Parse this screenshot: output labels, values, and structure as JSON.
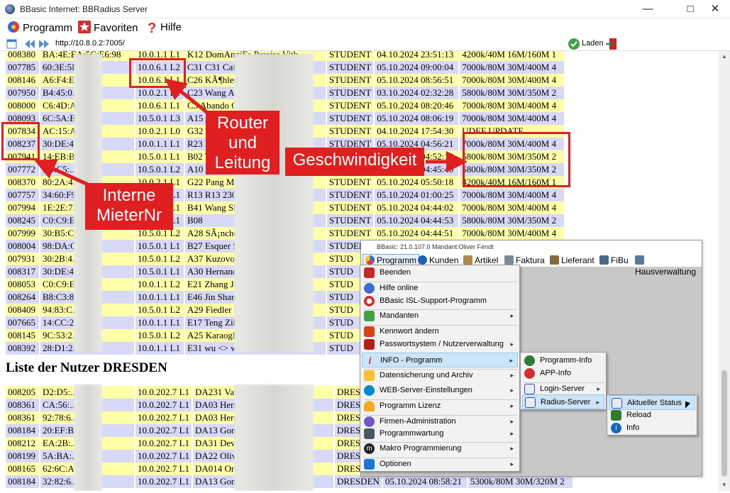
{
  "window": {
    "title": "BBasic Internet: BBRadius Server"
  },
  "menubar": {
    "programm": "Programm",
    "favoriten": "Favoriten",
    "hilfe": "Hilfe"
  },
  "address": {
    "url": "http://10.8.0.2:7005/",
    "load_label": "Laden"
  },
  "table1": {
    "rows": [
      [
        "008380",
        "BA:4E:EA:5C:E6:98",
        "10.0.1.1 L1",
        "K12 DomAngjEs Pereira Vith",
        "STUDENT",
        "04.10.2024 23:51:13",
        "4200k/40M 16M/160M 1"
      ],
      [
        "007785",
        "60:3E:5F:.. :99",
        "10.0.6.1 L2",
        "C31 C31 Café",
        "STUDENT",
        "05.10.2024 09:00:04",
        "7000k/80M 30M/400M 4"
      ],
      [
        "008146",
        "A6:F4:E.. :AF",
        "10.0.6.1 L1",
        "C26 KÃ¶hler",
        "STUDENT",
        "05.10.2024 08:56:51",
        "7000k/80M 30M/400M 4"
      ],
      [
        "007950",
        "B4:45:0.. :9C",
        "10.0.2.1 L1",
        "C23 Wang Ar",
        "STUDENT",
        "03.10.2024 02:32:28",
        "5800k/80M 30M/350M 2"
      ],
      [
        "008000",
        "C6:4D:A.. :C8",
        "10.0.6.1 L1",
        "C3 Abando C",
        "STUDENT",
        "05.10.2024 08:20:46",
        "7000k/80M 30M/400M 4"
      ],
      [
        "008093",
        "6C:5A:B.. :5F",
        "10.5.0.1 L3",
        "A15 A",
        "STUDENT",
        "05.10.2024 08:06:19",
        "7000k/80M 30M/400M 4"
      ],
      [
        "007834",
        "AC:15:A.. :23",
        "10.0.2.1 L0",
        "G32 T",
        "STUDENT",
        "04.10.2024 17:54:30",
        "UDEF UPDATE"
      ],
      [
        "008237",
        "30:DE:4.. :B5",
        "10.0.1.1 L1",
        "R23 M",
        "STUDENT",
        "05.10.2024 04:56:21",
        "7000k/80M 30M/400M 4"
      ],
      [
        "007941",
        "14:EB:B.. :94",
        "10.5.0.1 L1",
        "B02 W",
        "STUDENT",
        "05.10.2024 04:52:18",
        "5800k/80M 30M/350M 2"
      ],
      [
        "007772",
        "D0:C5:.. 60",
        "10.5.0.1 L2",
        "A10 A",
        "STUDENT",
        "05.10.2024 04:45:40",
        "5800k/80M 30M/350M 2"
      ],
      [
        "008370",
        "80:2A:4.. :C4",
        "10.0.2.1 L1",
        "G22 Pang Mu",
        "STUDENT",
        "05.10.2024 05:50:18",
        "4200k/40M 16M/160M 1"
      ],
      [
        "007757",
        "34:60:F9.. ",
        "10.0.1.1 L1",
        "R13 R13 230€",
        "STUDENT",
        "05.10.2024 01:00:25",
        "7000k/80M 30M/400M 4"
      ],
      [
        "007994",
        "1E:2E:7.. ",
        "10.5.0.1 L1",
        "B41 Wang Sh",
        "STUDENT",
        "05.10.2024 04:44:02",
        "7000k/80M 30M/400M 4"
      ],
      [
        "008245",
        "C0:C9:E.. ",
        "10.5.0.1 L1",
        "B08",
        "STUDENT",
        "05.10.2024 04:44:53",
        "5800k/80M 30M/350M 2"
      ],
      [
        "007999",
        "30:B5:C.. ",
        "10.5.0.1 L2",
        "A28 SÃ¡nche",
        "STUDENT",
        "05.10.2024 04:44:51",
        "7000k/80M 30M/400M 4"
      ],
      [
        "008004",
        "98:DA:C.. :79",
        "10.5.0.1 L1",
        "B27 Esquer S",
        "STUDENT",
        "05.10.2024 04:44:51",
        "7000k/80M 30M/400M 4"
      ],
      [
        "007931",
        "30:2B:4.. :89",
        "10.5.0.1 L2",
        "A37 Kuzovoi",
        "STUD",
        "",
        ""
      ],
      [
        "008317",
        "30:DE:4.. :B3",
        "10.5.0.1 L1",
        "A30 Hernand",
        "STUD",
        "",
        ""
      ],
      [
        "008053",
        "C0:C9:E.. :1C",
        "10.0.1.1 L2",
        "E21 Zhang Ji",
        "STUD",
        "",
        ""
      ],
      [
        "008264",
        "B8:C3:8.. :9D",
        "10.0.1.1 L1",
        "E46 Jin Shans",
        "STUD",
        "",
        ""
      ],
      [
        "008409",
        "94:83:C.. FC",
        "10.5.0.1 L2",
        "A29 Fiedler L",
        "STUD",
        "",
        ""
      ],
      [
        "007665",
        "14:CC:2.. :29",
        "10.0.1.1 L1",
        "E17 Teng Zih",
        "STUD",
        "",
        ""
      ],
      [
        "008145",
        "9C:53:2.. :F1",
        "10.5.0.1 L2",
        "A25 Karaoglu",
        "STUD",
        "",
        ""
      ],
      [
        "008392",
        "28:D1:2.. 0C",
        "10.0.1.1 L1",
        "E31 wu <> w",
        "STUD",
        "",
        ""
      ]
    ]
  },
  "section2_title": "Liste der Nutzer DRESDEN",
  "table2": {
    "rows": [
      [
        "008205",
        "D2:D5:.. A:19",
        "10.0.202.7 L1",
        "DA231 Vak",
        "DRESD",
        "",
        ""
      ],
      [
        "008361",
        "CA:56:.. A:34",
        "10.0.202.7 L1",
        "DA03 Herr",
        "DRESD",
        "",
        ""
      ],
      [
        "008361",
        "92:78:6.. 5B",
        "10.0.202.7 L1",
        "DA03 Herr",
        "DRESD",
        "",
        ""
      ],
      [
        "008184",
        "20:EF:B.. 2:1D",
        "10.0.202.7 L1",
        "DA13 Gonz",
        "DRESD",
        "",
        ""
      ],
      [
        "008212",
        "EA:2B:.. D",
        "10.0.202.7 L1",
        "DA31 Deve",
        "DRESD",
        "",
        ""
      ],
      [
        "008199",
        "5A:BA:.. :27",
        "10.0.202.7 L1",
        "DA22 Olive",
        "DRESD",
        "",
        ""
      ],
      [
        "008165",
        "62:6C:A.. :06",
        "10.0.202.7 L1",
        "DA014 Ord",
        "DRESD",
        "",
        ""
      ],
      [
        "008184",
        "32:82:6.. A7",
        "10.0.202.7 L1",
        "DA13 Gonz",
        "DRESDEN",
        "05.10.2024 08:58:21",
        "5300k/80M 30M/320M 2"
      ]
    ]
  },
  "annotations": {
    "router": "Router und Leitung",
    "speed": "Geschwindigkeit",
    "tenant": "Interne MieterNr"
  },
  "inset": {
    "title": "BBasic: 21.0.107.0 Mandant:Oliver Fendt",
    "menus": [
      "Programm",
      "Kunden",
      "Artikel",
      "Faktura",
      "Lieferant",
      "FiBu",
      "Hausverwaltung"
    ],
    "dropdown": [
      "Beenden",
      "Hilfe online",
      "BBasic ISL-Support-Programm",
      "Mandanten",
      "Kennwort ändern",
      "Passwortsystem / Nutzerverwaltung",
      "INFO - Programm",
      "Datensicherung und Archiv",
      "WEB-Server-Einstellungen",
      "Programm Lizenz",
      "Firmen-Administration",
      "Programmwartung",
      "Makro Programmierung",
      "Optionen"
    ],
    "info_submenu": [
      "Programm-Info",
      "APP-Info",
      "Login-Server",
      "Radius-Server"
    ],
    "radius_submenu": [
      "Aktueller Status",
      "Reload",
      "Info"
    ]
  },
  "colors": {
    "accent": "#e02020",
    "row_yellow": "#ffffa8",
    "row_lavender": "#d8d8f8"
  }
}
